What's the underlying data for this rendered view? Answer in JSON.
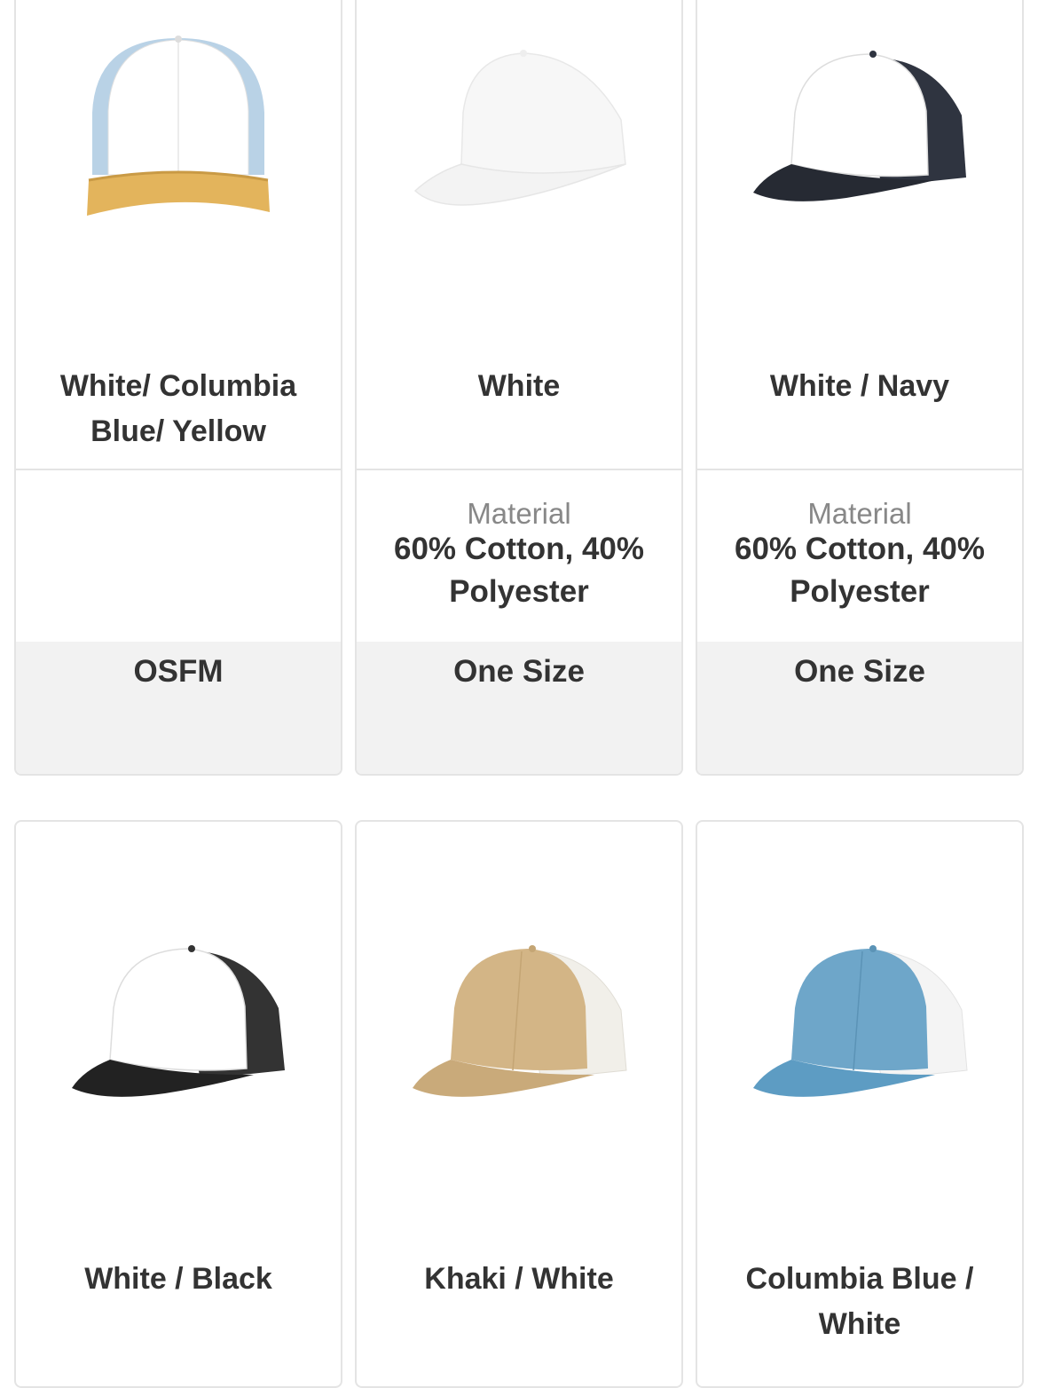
{
  "products": [
    {
      "color_name": "White/ Columbia Blue/ Yellow",
      "size": "OSFM",
      "icon": "trucker-cap-white-columbia-blue-yellow-icon"
    },
    {
      "color_name": "White",
      "material_label": "Material",
      "material": "60% Cotton, 40% Polyester",
      "size": "One Size",
      "icon": "trucker-cap-white-icon"
    },
    {
      "color_name": "White / Navy",
      "material_label": "Material",
      "material": "60% Cotton, 40% Polyester",
      "size": "One Size",
      "icon": "trucker-cap-white-navy-icon"
    },
    {
      "color_name": "White / Black",
      "icon": "trucker-cap-white-black-icon"
    },
    {
      "color_name": "Khaki / White",
      "icon": "trucker-cap-khaki-white-icon"
    },
    {
      "color_name": "Columbia Blue / White",
      "icon": "trucker-cap-columbia-blue-white-icon"
    }
  ],
  "colors": {
    "border": "#e4e4e4",
    "size_band": "#f2f2f2",
    "text": "#333333",
    "muted_text": "#888888"
  }
}
